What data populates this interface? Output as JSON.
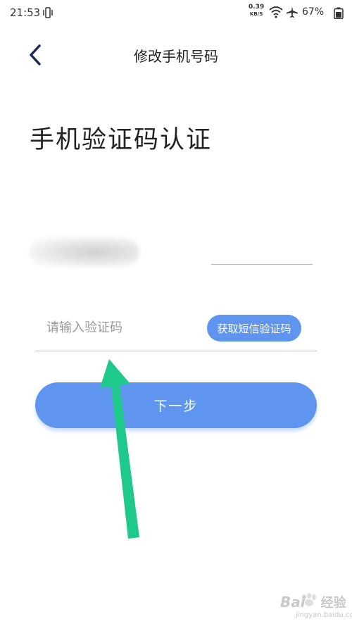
{
  "status_bar": {
    "time": "21:53",
    "net_speed_value": "0.39",
    "net_speed_unit": "KB/S",
    "battery": "67%"
  },
  "header": {
    "title": "修改手机号码",
    "back_icon": "chevron-left-icon"
  },
  "main": {
    "heading": "手机验证码认证",
    "phone_value": "",
    "code_placeholder": "请输入验证码",
    "sms_button_label": "获取短信验证码",
    "next_button_label": "下一步"
  },
  "annotation": {
    "arrow_icon": "arrow-up-icon",
    "arrow_color": "#1fc98b"
  },
  "watermark": {
    "brand": "Bai",
    "brand_suffix": "经验",
    "url": "jingyan.baidu.com"
  },
  "colors": {
    "accent": "#5f95ef",
    "back_icon": "#1e2a55"
  }
}
